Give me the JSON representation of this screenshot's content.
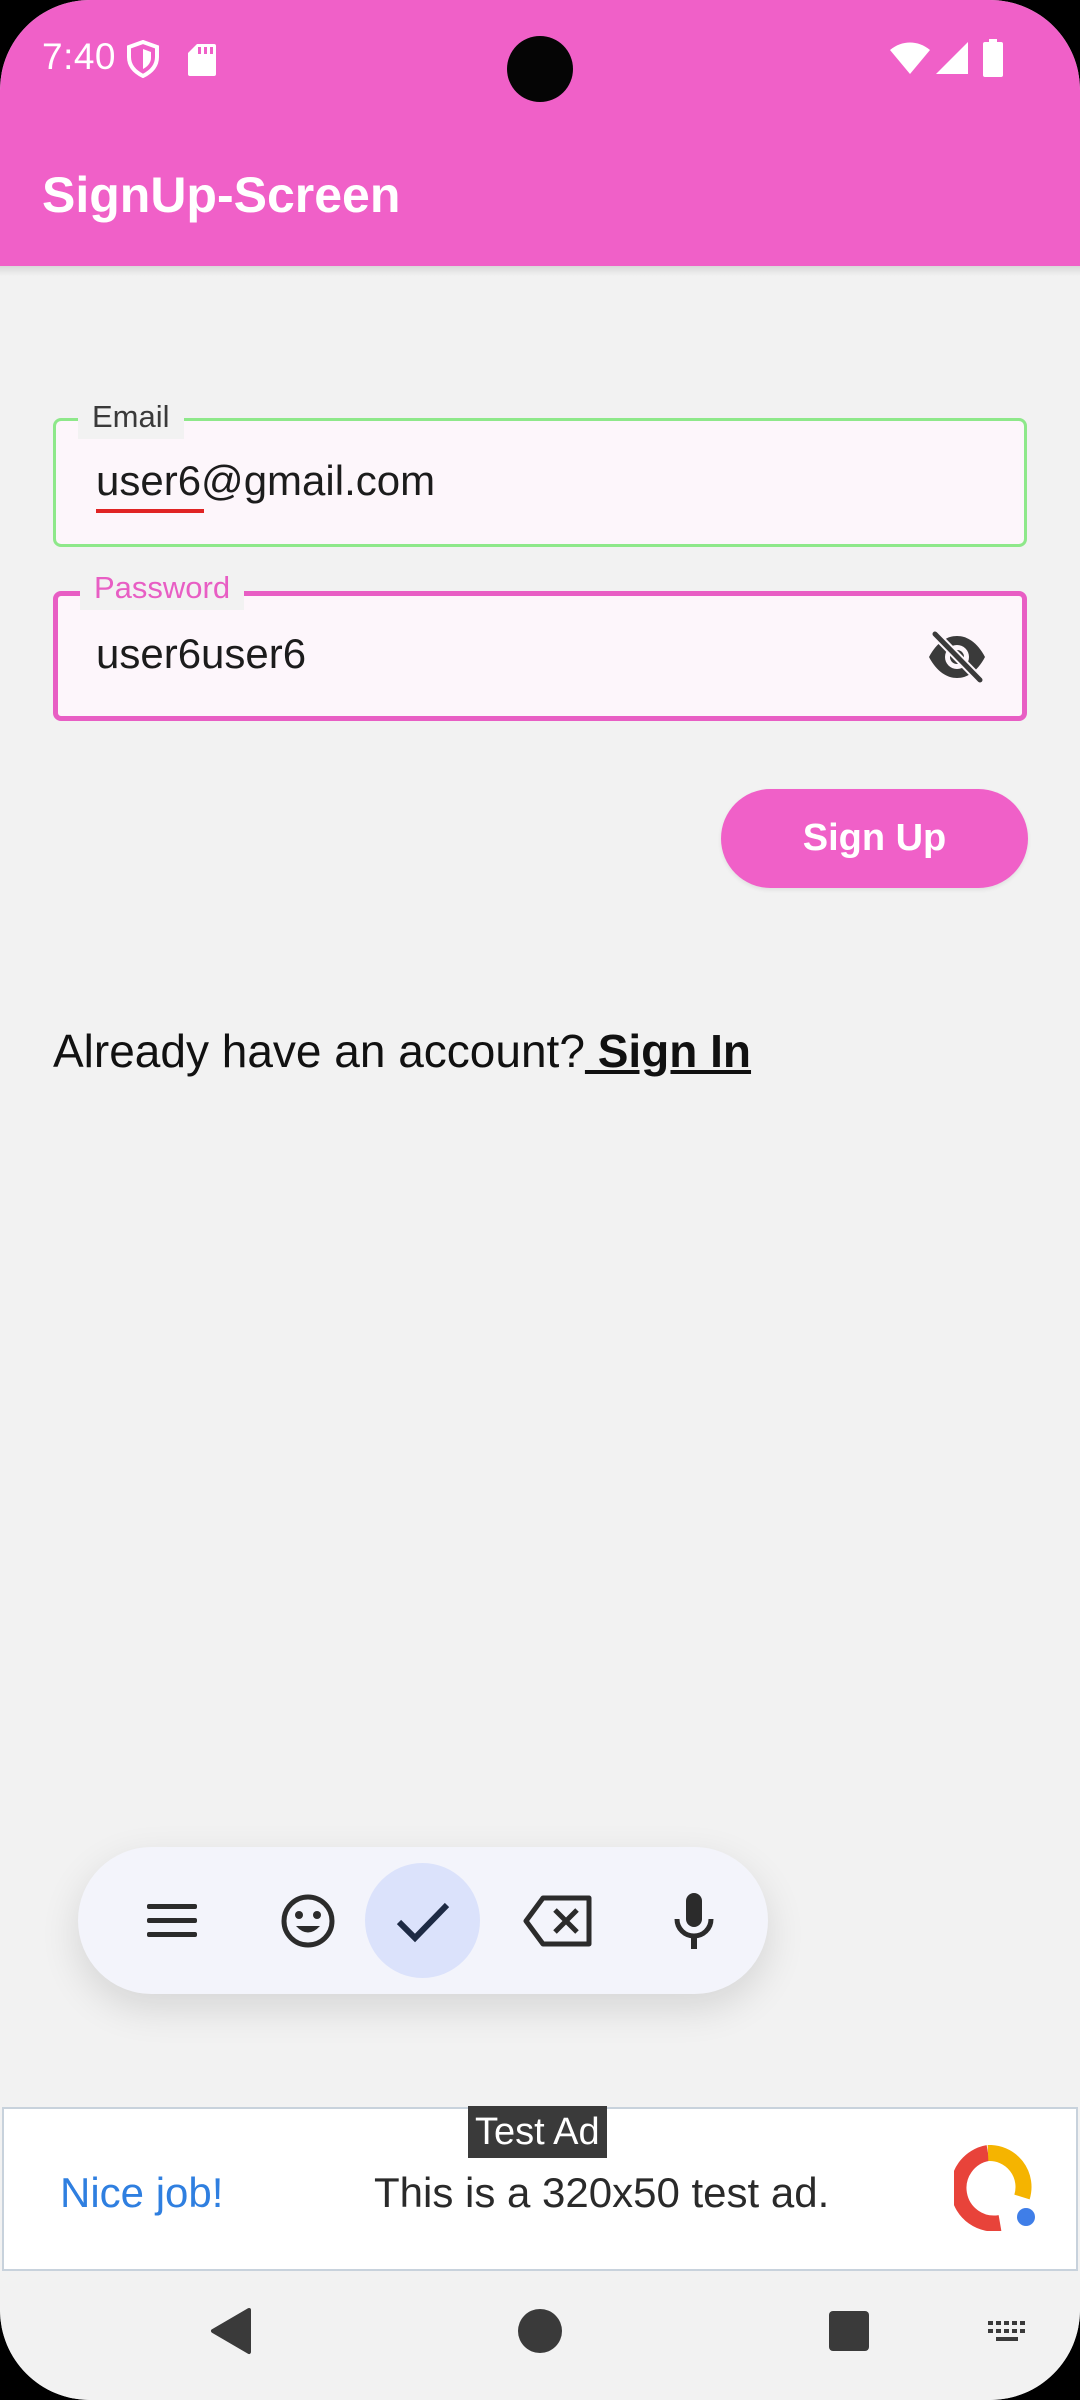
{
  "status_bar": {
    "time": "7:40",
    "icons": [
      "shield-icon",
      "sd-card-icon",
      "wifi-icon",
      "signal-icon",
      "battery-icon"
    ]
  },
  "app_bar": {
    "title": "SignUp-Screen",
    "color": "#f060c8"
  },
  "form": {
    "email": {
      "label": "Email",
      "value": "user6@gmail.com",
      "border_color": "#8ee88a"
    },
    "password": {
      "label": "Password",
      "value": "user6user6",
      "border_color": "#e85ec4",
      "visibility_icon": "visibility-off-icon"
    },
    "signup_button": "Sign Up"
  },
  "signin_prompt": {
    "text": "Already have an account?",
    "link": " Sign In"
  },
  "keyboard_toolbar": {
    "buttons": [
      "menu-icon",
      "emoji-icon",
      "check-icon",
      "backspace-icon",
      "microphone-icon"
    ],
    "active": "check-icon"
  },
  "ad": {
    "badge": "Test Ad",
    "headline": "Nice job!",
    "body": "This is a 320x50 test ad."
  },
  "nav_bar": {
    "buttons": [
      "back-icon",
      "home-icon",
      "recents-icon",
      "keyboard-icon"
    ]
  }
}
